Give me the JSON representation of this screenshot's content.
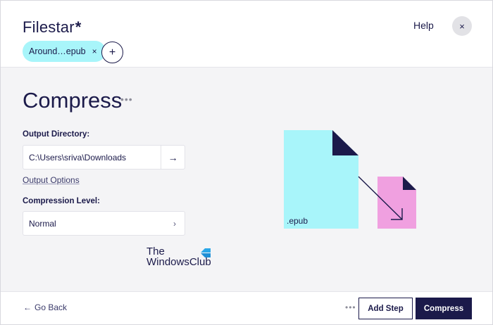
{
  "header": {
    "brand": "Filestar",
    "brand_star": "*",
    "help_label": "Help",
    "close_icon": "×",
    "file_chip": {
      "label": "Around…epub",
      "remove_icon": "×"
    },
    "add_file_icon": "+"
  },
  "main": {
    "title": "Compress",
    "more_icon": "•••",
    "output_directory": {
      "label": "Output Directory:",
      "value": "C:\\Users\\sriva\\Downloads",
      "arrow_icon": "→"
    },
    "output_options_label": "Output Options",
    "compression_level": {
      "label": "Compression Level:",
      "value": "Normal",
      "chevron_icon": "›"
    },
    "watermark": {
      "line1": "The",
      "line2": "WindowsClub"
    },
    "illustration": {
      "file_ext_label": ".epub"
    }
  },
  "footer": {
    "go_back_icon": "←",
    "go_back_label": "Go Back",
    "more_icon": "•••",
    "add_step_label": "Add Step",
    "compress_label": "Compress"
  },
  "colors": {
    "navy": "#1b1a4a",
    "cyan_file": "#a8f5fa",
    "pink_file": "#f0a0e0",
    "panel_bg": "#f4f4f6"
  }
}
